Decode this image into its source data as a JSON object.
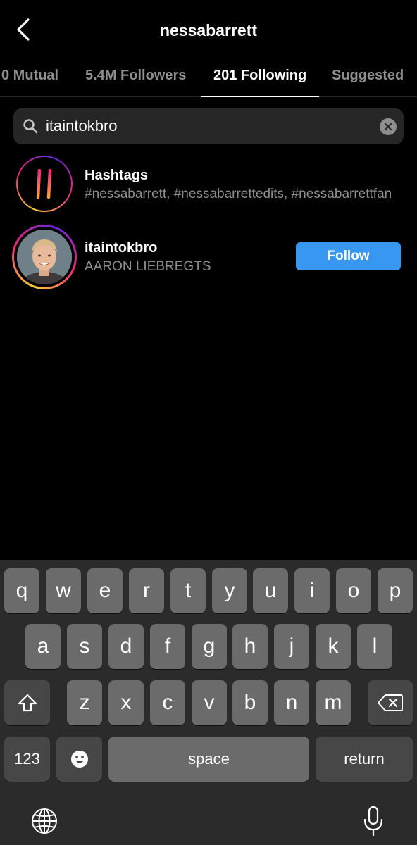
{
  "header": {
    "title": "nessabarrett"
  },
  "tabs": [
    {
      "label": "0 Mutual"
    },
    {
      "label": "5.4M Followers"
    },
    {
      "label": "201 Following",
      "active": true
    },
    {
      "label": "Suggested"
    }
  ],
  "search": {
    "value": "itaintokbro"
  },
  "results": {
    "hashtags": {
      "title": "Hashtags",
      "subtitle": "#nessabarrett, #nessabarrettedits, #nessabarrettfan"
    },
    "user": {
      "username": "itaintokbro",
      "full_name": "AARON LIEBREGTS",
      "button_label": "Follow"
    }
  },
  "keyboard": {
    "row1": [
      "q",
      "w",
      "e",
      "r",
      "t",
      "y",
      "u",
      "i",
      "o",
      "p"
    ],
    "row2": [
      "a",
      "s",
      "d",
      "f",
      "g",
      "h",
      "j",
      "k",
      "l"
    ],
    "row3": [
      "z",
      "x",
      "c",
      "v",
      "b",
      "n",
      "m"
    ],
    "numbers_label": "123",
    "space_label": "space",
    "return_label": "return"
  },
  "colors": {
    "accent": "#3897f0",
    "background": "#000000",
    "secondary_text": "#8e8e8e"
  },
  "icons": [
    "back-chevron-icon",
    "search-icon",
    "clear-icon",
    "hashtag-icon",
    "shift-icon",
    "backspace-icon",
    "emoji-icon",
    "globe-icon",
    "microphone-icon"
  ]
}
